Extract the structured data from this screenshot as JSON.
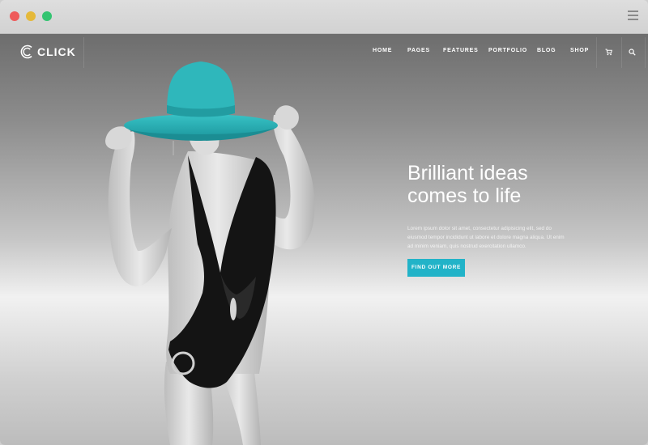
{
  "window": {
    "controls": [
      "close",
      "minimize",
      "maximize"
    ],
    "menu_icon": "hamburger-icon"
  },
  "brand": {
    "name": "CLICK",
    "logo_icon": "click-logo-icon"
  },
  "nav": {
    "items": [
      "HOME",
      "PAGES",
      "FEATURES",
      "PORTFOLIO",
      "BLOG",
      "SHOP"
    ],
    "cart_icon": "cart-icon",
    "search_icon": "search-icon"
  },
  "hero": {
    "headline_line1": "Brilliant ideas",
    "headline_line2": "comes to life",
    "body": "Lorem ipsum dolor sit amet, consectetur adipisicing elit, sed do eiusmod tempor incididunt ut labore et dolore magna aliqua. Ut enim ad minim veniam, quis nostrud exercitation ullamco.",
    "cta_label": "FIND OUT MORE"
  },
  "colors": {
    "accent": "#22b3c8",
    "hat": "#2fb7bb",
    "swimsuit": "#141414"
  }
}
